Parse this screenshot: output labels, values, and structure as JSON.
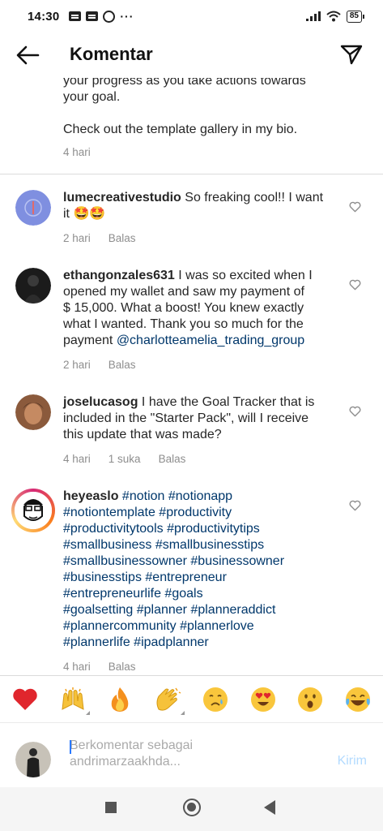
{
  "status_bar": {
    "time": "14:30",
    "battery": "85"
  },
  "header": {
    "title": "Komentar"
  },
  "caption": {
    "line_partial": "your progress as you take actions towards",
    "line_2": "your goal.",
    "line_3": "Check out the template gallery in my bio.",
    "time": "4 hari"
  },
  "comments": [
    {
      "username": "lumecreativestudio",
      "text_line1": " So freaking cool!! I want",
      "text_line2": "it 🤩🤩",
      "time": "2 hari",
      "reply": "Balas"
    },
    {
      "username": "ethangonzales631",
      "text_line1": " I was so excited when I",
      "text_line2": "opened my wallet and saw my payment of",
      "text_line3": "$ 15,000.  What a boost!  You knew exactly",
      "text_line4": "what I wanted.  Thank you so much for the",
      "text_line5": "payment  ",
      "mention": "@charlotteamelia_trading_group",
      "time": "2 hari",
      "reply": "Balas"
    },
    {
      "username": "joselucasog",
      "text_line1": " I have the Goal Tracker that is",
      "text_line2": "included in the \"Starter Pack\", will I receive",
      "text_line3": "this update that was made?",
      "time": "4 hari",
      "likes": "1 suka",
      "reply": "Balas"
    },
    {
      "username": "heyeaslo",
      "tags_line1": " #notion #notionapp",
      "tags_lines": [
        "#notiontemplate #productivity",
        "#productivitytools #productivitytips",
        "#smallbusiness #smallbusinesstips",
        "#smallbusinessowner #businessowner",
        "#businesstips #entrepreneur",
        "#entrepreneurlife #goals",
        "#goalsetting #planner #planneraddict",
        "#plannercommunity #plannerlove",
        "#plannerlife #ipadplanner"
      ],
      "time": "4 hari",
      "reply": "Balas"
    }
  ],
  "emoji_bar": [
    "❤️",
    "🙌",
    "🔥",
    "👏",
    "😢",
    "😍",
    "😮",
    "😂"
  ],
  "input": {
    "placeholder": "Berkomentar sebagai andrimarzaakhda...",
    "placeholder_line1": "Berkomentar sebagai",
    "placeholder_line2": "andrimarzaakhda...",
    "post_label": "Kirim"
  },
  "colors": {
    "link": "#00376b",
    "meta": "#8e8e8e",
    "post_disabled": "#b3dbff",
    "heart_red": "#ed4956"
  }
}
